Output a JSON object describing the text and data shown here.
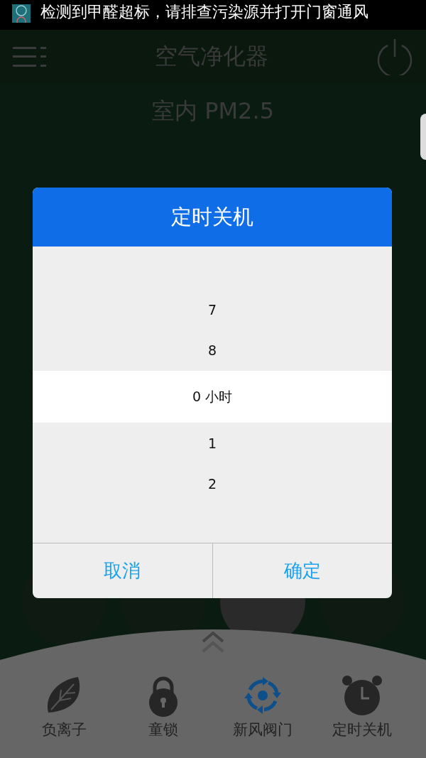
{
  "notification": {
    "text": "检测到甲醛超标，请排查污染源并打开门窗通风"
  },
  "app_bar": {
    "title": "空气净化器"
  },
  "indoor_label": "室内 PM2.5",
  "dialog": {
    "title": "定时关机",
    "picker": [
      {
        "label": "7",
        "selected": false
      },
      {
        "label": "8",
        "selected": false
      },
      {
        "label": "0 小时",
        "selected": true
      },
      {
        "label": "1",
        "selected": false
      },
      {
        "label": "2",
        "selected": false
      }
    ],
    "buttons": [
      "取消",
      "确定"
    ]
  },
  "bottom_bar": [
    {
      "kind": "leaf",
      "label": "负离子",
      "active": false
    },
    {
      "kind": "lock",
      "label": "童锁",
      "active": false
    },
    {
      "kind": "valve",
      "label": "新风阀门",
      "active": true
    },
    {
      "kind": "timer",
      "label": "定时关机",
      "active": false
    }
  ]
}
